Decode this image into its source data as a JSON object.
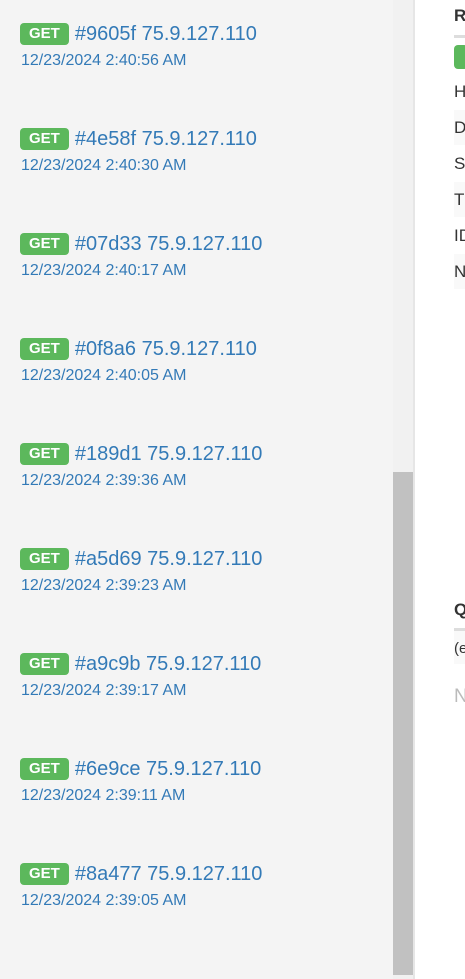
{
  "requests": [
    {
      "method": "GET",
      "title": "#9605f 75.9.127.110",
      "date": "12/23/2024 2:40:56 AM"
    },
    {
      "method": "GET",
      "title": "#4e58f 75.9.127.110",
      "date": "12/23/2024 2:40:30 AM"
    },
    {
      "method": "GET",
      "title": "#07d33 75.9.127.110",
      "date": "12/23/2024 2:40:17 AM"
    },
    {
      "method": "GET",
      "title": "#0f8a6 75.9.127.110",
      "date": "12/23/2024 2:40:05 AM"
    },
    {
      "method": "GET",
      "title": "#189d1 75.9.127.110",
      "date": "12/23/2024 2:39:36 AM"
    },
    {
      "method": "GET",
      "title": "#a5d69 75.9.127.110",
      "date": "12/23/2024 2:39:23 AM"
    },
    {
      "method": "GET",
      "title": "#a9c9b 75.9.127.110",
      "date": "12/23/2024 2:39:17 AM"
    },
    {
      "method": "GET",
      "title": "#6e9ce 75.9.127.110",
      "date": "12/23/2024 2:39:11 AM"
    },
    {
      "method": "GET",
      "title": "#8a477 75.9.127.110",
      "date": "12/23/2024 2:39:05 AM"
    }
  ],
  "detail": {
    "heading": "R",
    "rows": [
      "H",
      "D",
      "S",
      "T",
      "ID",
      "N"
    ],
    "query_heading": "Q",
    "query_value": "(e",
    "none_text": "N"
  },
  "colors": {
    "badge": "#5cb85c",
    "link": "#337ab7"
  }
}
